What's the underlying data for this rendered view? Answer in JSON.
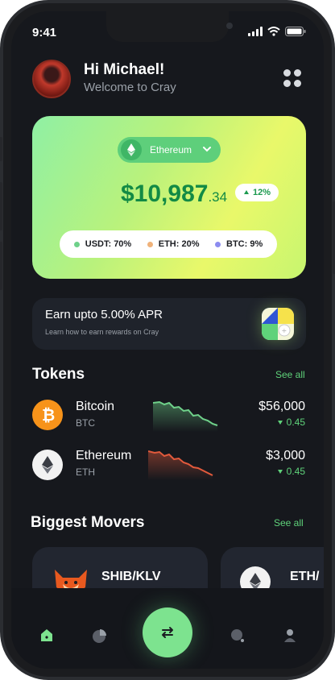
{
  "status_bar": {
    "time": "9:41"
  },
  "header": {
    "greeting": "Hi Michael!",
    "subtitle": "Welcome to Cray",
    "avatar_icon": "user-avatar",
    "menu_icon": "grid-menu-icon"
  },
  "balance_card": {
    "asset": "Ethereum",
    "asset_icon": "ethereum-icon",
    "balance_main": "$10,987",
    "balance_cents": ".34",
    "change": "12%",
    "change_direction": "up",
    "allocation": [
      {
        "label": "USDT: 70%",
        "color": "#6fd18a"
      },
      {
        "label": "ETH: 20%",
        "color": "#f0b27a"
      },
      {
        "label": "BTC: 9%",
        "color": "#8c8cf0"
      }
    ]
  },
  "apr_banner": {
    "title": "Earn upto 5.00% APR",
    "subtitle": "Learn how to earn rewards on Cray"
  },
  "tokens": {
    "title": "Tokens",
    "see_all": "See all",
    "items": [
      {
        "name": "Bitcoin",
        "symbol": "BTC",
        "price": "$56,000",
        "change": "0.45",
        "change_direction": "down",
        "icon": "bitcoin-icon",
        "color": "#f7931a"
      },
      {
        "name": "Ethereum",
        "symbol": "ETH",
        "price": "$3,000",
        "change": "0.45",
        "change_direction": "down",
        "icon": "ethereum-icon",
        "color": "#ffffff"
      }
    ]
  },
  "movers": {
    "title": "Biggest Movers",
    "see_all": "See all",
    "items": [
      {
        "pair": "SHIB/KLV",
        "icon": "shiba-icon"
      },
      {
        "pair": "ETH/",
        "icon": "ethereum-icon"
      }
    ]
  },
  "tabbar": {
    "tabs": [
      "home-icon",
      "portfolio-icon",
      "swap-icon",
      "search-icon",
      "profile-icon"
    ],
    "accent": "#7de38f"
  }
}
